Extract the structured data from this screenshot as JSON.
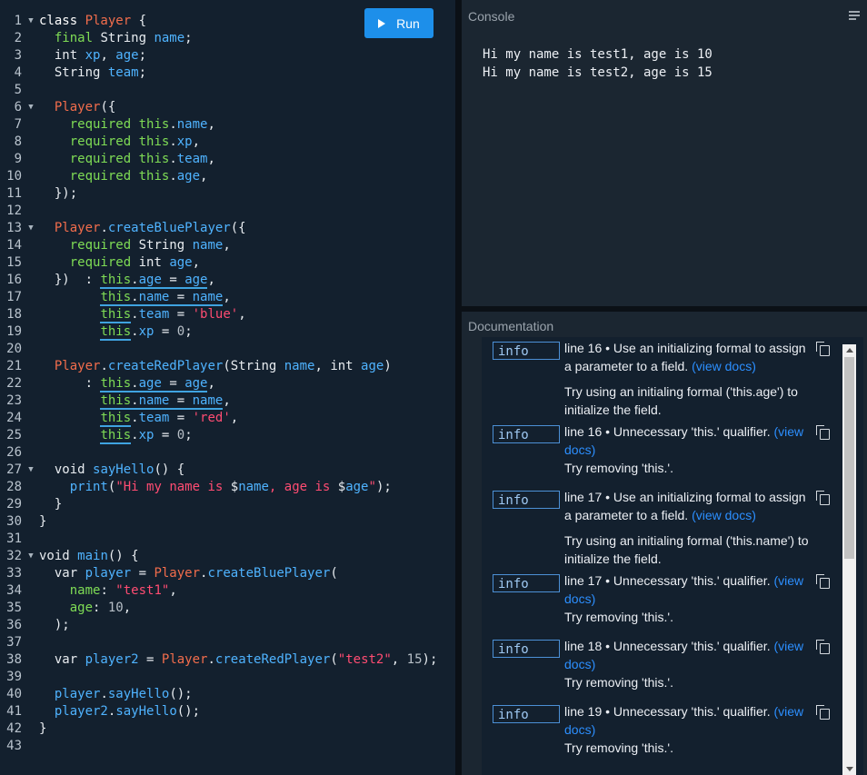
{
  "run_label": "Run",
  "console": {
    "title": "Console",
    "output": [
      "Hi my name is test1, age is 10",
      "Hi my name is test2, age is 15"
    ]
  },
  "docs": {
    "title": "Documentation",
    "view_docs": "(view docs)",
    "issues": [
      {
        "badge": "info",
        "msg": "line 16 • Use an initializing formal to assign a parameter to a field.",
        "fix": "Try using an initialing formal ('this.age') to initialize the field."
      },
      {
        "badge": "info",
        "msg": "line 16 • Unnecessary 'this.' qualifier.",
        "fix": "Try removing 'this.'."
      },
      {
        "badge": "info",
        "msg": "line 17 • Use an initializing formal to assign a parameter to a field.",
        "fix": "Try using an initialing formal ('this.name') to initialize the field."
      },
      {
        "badge": "info",
        "msg": "line 17 • Unnecessary 'this.' qualifier.",
        "fix": "Try removing 'this.'."
      },
      {
        "badge": "info",
        "msg": "line 18 • Unnecessary 'this.' qualifier.",
        "fix": "Try removing 'this.'."
      },
      {
        "badge": "info",
        "msg": "line 19 • Unnecessary 'this.' qualifier.",
        "fix": "Try removing 'this.'."
      }
    ]
  },
  "code": [
    {
      "n": 1,
      "f": true,
      "t": [
        [
          "k",
          "class "
        ],
        [
          "cls",
          "Player"
        ],
        [
          "pl",
          " {"
        ]
      ]
    },
    {
      "n": 2,
      "t": [
        [
          "pl",
          "  "
        ],
        [
          "kw",
          "final"
        ],
        [
          "pl",
          " String "
        ],
        [
          "fld",
          "name"
        ],
        [
          "pl",
          ";"
        ]
      ]
    },
    {
      "n": 3,
      "t": [
        [
          "pl",
          "  int "
        ],
        [
          "fld",
          "xp"
        ],
        [
          "pl",
          ", "
        ],
        [
          "fld",
          "age"
        ],
        [
          "pl",
          ";"
        ]
      ]
    },
    {
      "n": 4,
      "t": [
        [
          "pl",
          "  String "
        ],
        [
          "fld",
          "team"
        ],
        [
          "pl",
          ";"
        ]
      ]
    },
    {
      "n": 5,
      "t": []
    },
    {
      "n": 6,
      "f": true,
      "t": [
        [
          "pl",
          "  "
        ],
        [
          "cls",
          "Player"
        ],
        [
          "pl",
          "({"
        ]
      ]
    },
    {
      "n": 7,
      "t": [
        [
          "pl",
          "    "
        ],
        [
          "kw",
          "required"
        ],
        [
          "pl",
          " "
        ],
        [
          "kw",
          "this"
        ],
        [
          "pl",
          "."
        ],
        [
          "fld",
          "name"
        ],
        [
          "pl",
          ","
        ]
      ]
    },
    {
      "n": 8,
      "t": [
        [
          "pl",
          "    "
        ],
        [
          "kw",
          "required"
        ],
        [
          "pl",
          " "
        ],
        [
          "kw",
          "this"
        ],
        [
          "pl",
          "."
        ],
        [
          "fld",
          "xp"
        ],
        [
          "pl",
          ","
        ]
      ]
    },
    {
      "n": 9,
      "t": [
        [
          "pl",
          "    "
        ],
        [
          "kw",
          "required"
        ],
        [
          "pl",
          " "
        ],
        [
          "kw",
          "this"
        ],
        [
          "pl",
          "."
        ],
        [
          "fld",
          "team"
        ],
        [
          "pl",
          ","
        ]
      ]
    },
    {
      "n": 10,
      "t": [
        [
          "pl",
          "    "
        ],
        [
          "kw",
          "required"
        ],
        [
          "pl",
          " "
        ],
        [
          "kw",
          "this"
        ],
        [
          "pl",
          "."
        ],
        [
          "fld",
          "age"
        ],
        [
          "pl",
          ","
        ]
      ]
    },
    {
      "n": 11,
      "t": [
        [
          "pl",
          "  });"
        ]
      ]
    },
    {
      "n": 12,
      "t": []
    },
    {
      "n": 13,
      "f": true,
      "t": [
        [
          "pl",
          "  "
        ],
        [
          "cls",
          "Player"
        ],
        [
          "pl",
          "."
        ],
        [
          "fld",
          "createBluePlayer"
        ],
        [
          "pl",
          "({"
        ]
      ]
    },
    {
      "n": 14,
      "t": [
        [
          "pl",
          "    "
        ],
        [
          "kw",
          "required"
        ],
        [
          "pl",
          " String "
        ],
        [
          "fld",
          "name"
        ],
        [
          "pl",
          ","
        ]
      ]
    },
    {
      "n": 15,
      "t": [
        [
          "pl",
          "    "
        ],
        [
          "kw",
          "required"
        ],
        [
          "pl",
          " int "
        ],
        [
          "fld",
          "age"
        ],
        [
          "pl",
          ","
        ]
      ]
    },
    {
      "n": 16,
      "t": [
        [
          "pl",
          "  })  : "
        ],
        [
          "tt",
          "this",
          "u"
        ],
        [
          "pl",
          ".",
          "u"
        ],
        [
          "fld",
          "age",
          "u"
        ],
        [
          "pl",
          " = ",
          "u"
        ],
        [
          "fld",
          "age",
          "u"
        ],
        [
          "pl",
          ","
        ]
      ]
    },
    {
      "n": 17,
      "t": [
        [
          "pl",
          "        "
        ],
        [
          "tt",
          "this",
          "u"
        ],
        [
          "pl",
          ".",
          "u"
        ],
        [
          "fld",
          "name",
          "u"
        ],
        [
          "pl",
          " = ",
          "u"
        ],
        [
          "fld",
          "name",
          "u"
        ],
        [
          "pl",
          ","
        ]
      ]
    },
    {
      "n": 18,
      "t": [
        [
          "pl",
          "        "
        ],
        [
          "tt",
          "this",
          "u"
        ],
        [
          "pl",
          "."
        ],
        [
          "fld",
          "team"
        ],
        [
          "pl",
          " = "
        ],
        [
          "str",
          "'blue'"
        ],
        [
          "pl",
          ","
        ]
      ]
    },
    {
      "n": 19,
      "t": [
        [
          "pl",
          "        "
        ],
        [
          "tt",
          "this",
          "u"
        ],
        [
          "pl",
          "."
        ],
        [
          "fld",
          "xp"
        ],
        [
          "pl",
          " = "
        ],
        [
          "num",
          "0"
        ],
        [
          "pl",
          ";"
        ]
      ]
    },
    {
      "n": 20,
      "t": []
    },
    {
      "n": 21,
      "t": [
        [
          "pl",
          "  "
        ],
        [
          "cls",
          "Player"
        ],
        [
          "pl",
          "."
        ],
        [
          "fld",
          "createRedPlayer"
        ],
        [
          "pl",
          "(String "
        ],
        [
          "fld",
          "name"
        ],
        [
          "pl",
          ", int "
        ],
        [
          "fld",
          "age"
        ],
        [
          "pl",
          ")"
        ]
      ]
    },
    {
      "n": 22,
      "t": [
        [
          "pl",
          "      : "
        ],
        [
          "tt",
          "this",
          "u"
        ],
        [
          "pl",
          ".",
          "u"
        ],
        [
          "fld",
          "age",
          "u"
        ],
        [
          "pl",
          " = ",
          "u"
        ],
        [
          "fld",
          "age",
          "u"
        ],
        [
          "pl",
          ","
        ]
      ]
    },
    {
      "n": 23,
      "t": [
        [
          "pl",
          "        "
        ],
        [
          "tt",
          "this",
          "u"
        ],
        [
          "pl",
          ".",
          "u"
        ],
        [
          "fld",
          "name",
          "u"
        ],
        [
          "pl",
          " = ",
          "u"
        ],
        [
          "fld",
          "name",
          "u"
        ],
        [
          "pl",
          ","
        ]
      ]
    },
    {
      "n": 24,
      "t": [
        [
          "pl",
          "        "
        ],
        [
          "tt",
          "this",
          "u"
        ],
        [
          "pl",
          "."
        ],
        [
          "fld",
          "team"
        ],
        [
          "pl",
          " = "
        ],
        [
          "str",
          "'red'"
        ],
        [
          "pl",
          ","
        ]
      ]
    },
    {
      "n": 25,
      "t": [
        [
          "pl",
          "        "
        ],
        [
          "tt",
          "this",
          "u"
        ],
        [
          "pl",
          "."
        ],
        [
          "fld",
          "xp"
        ],
        [
          "pl",
          " = "
        ],
        [
          "num",
          "0"
        ],
        [
          "pl",
          ";"
        ]
      ]
    },
    {
      "n": 26,
      "t": []
    },
    {
      "n": 27,
      "f": true,
      "t": [
        [
          "pl",
          "  void "
        ],
        [
          "fld",
          "sayHello"
        ],
        [
          "pl",
          "() {"
        ]
      ]
    },
    {
      "n": 28,
      "t": [
        [
          "pl",
          "    "
        ],
        [
          "fld",
          "print"
        ],
        [
          "pl",
          "("
        ],
        [
          "str",
          "\"Hi my name is "
        ],
        [
          "pl",
          "$"
        ],
        [
          "fld",
          "name"
        ],
        [
          "str",
          ", age is "
        ],
        [
          "pl",
          "$"
        ],
        [
          "fld",
          "age"
        ],
        [
          "str",
          "\""
        ],
        [
          "pl",
          ");"
        ]
      ]
    },
    {
      "n": 29,
      "t": [
        [
          "pl",
          "  }"
        ]
      ]
    },
    {
      "n": 30,
      "t": [
        [
          "pl",
          "}"
        ]
      ]
    },
    {
      "n": 31,
      "t": []
    },
    {
      "n": 32,
      "f": true,
      "t": [
        [
          "pl",
          "void "
        ],
        [
          "fld",
          "main"
        ],
        [
          "pl",
          "() {"
        ]
      ]
    },
    {
      "n": 33,
      "t": [
        [
          "pl",
          "  var "
        ],
        [
          "fld",
          "player"
        ],
        [
          "pl",
          " = "
        ],
        [
          "cls",
          "Player"
        ],
        [
          "pl",
          "."
        ],
        [
          "fld",
          "createBluePlayer"
        ],
        [
          "pl",
          "("
        ]
      ]
    },
    {
      "n": 34,
      "t": [
        [
          "pl",
          "    "
        ],
        [
          "tt",
          "name"
        ],
        [
          "pl",
          ": "
        ],
        [
          "str",
          "\"test1\""
        ],
        [
          "pl",
          ","
        ]
      ]
    },
    {
      "n": 35,
      "t": [
        [
          "pl",
          "    "
        ],
        [
          "tt",
          "age"
        ],
        [
          "pl",
          ": "
        ],
        [
          "num",
          "10"
        ],
        [
          "pl",
          ","
        ]
      ]
    },
    {
      "n": 36,
      "t": [
        [
          "pl",
          "  );"
        ]
      ]
    },
    {
      "n": 37,
      "t": []
    },
    {
      "n": 38,
      "t": [
        [
          "pl",
          "  var "
        ],
        [
          "fld",
          "player2"
        ],
        [
          "pl",
          " = "
        ],
        [
          "cls",
          "Player"
        ],
        [
          "pl",
          "."
        ],
        [
          "fld",
          "createRedPlayer"
        ],
        [
          "pl",
          "("
        ],
        [
          "str",
          "\"test2\""
        ],
        [
          "pl",
          ", "
        ],
        [
          "num",
          "15"
        ],
        [
          "pl",
          ");"
        ]
      ]
    },
    {
      "n": 39,
      "t": []
    },
    {
      "n": 40,
      "t": [
        [
          "pl",
          "  "
        ],
        [
          "fld",
          "player"
        ],
        [
          "pl",
          "."
        ],
        [
          "fld",
          "sayHello"
        ],
        [
          "pl",
          "();"
        ]
      ]
    },
    {
      "n": 41,
      "t": [
        [
          "pl",
          "  "
        ],
        [
          "fld",
          "player2"
        ],
        [
          "pl",
          "."
        ],
        [
          "fld",
          "sayHello"
        ],
        [
          "pl",
          "();"
        ]
      ]
    },
    {
      "n": 42,
      "t": [
        [
          "pl",
          "}"
        ]
      ]
    },
    {
      "n": 43,
      "t": []
    }
  ]
}
